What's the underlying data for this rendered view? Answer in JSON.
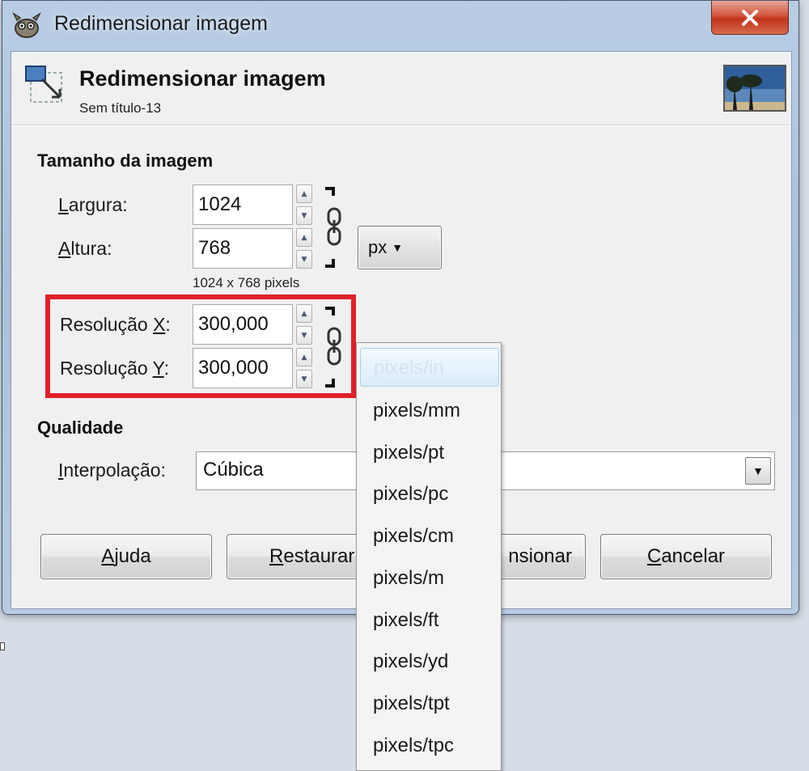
{
  "window": {
    "title": "Redimensionar imagem"
  },
  "dialog": {
    "title": "Redimensionar imagem",
    "subtitle": "Sem título-13"
  },
  "image_size": {
    "section_title": "Tamanho da imagem",
    "width": {
      "label_mnemonic": "L",
      "label_rest": "argura:",
      "value": "1024"
    },
    "height": {
      "label_mnemonic": "A",
      "label_rest": "ltura:",
      "value": "768"
    },
    "unit": "px",
    "pixels_note": "1024 x 768 pixels",
    "resolution_x": {
      "label_pre": "Resolução ",
      "label_mnemonic": "X",
      "label_post": ":",
      "value": "300,000"
    },
    "resolution_y": {
      "label_pre": "Resolução ",
      "label_mnemonic": "Y",
      "label_post": ":",
      "value": "300,000"
    }
  },
  "quality": {
    "section_title": "Qualidade",
    "interpolation": {
      "label_mnemonic": "I",
      "label_rest": "nterpolação:",
      "value": "Cúbica"
    }
  },
  "buttons": {
    "help": {
      "mnemonic": "A",
      "rest": "juda"
    },
    "reset": {
      "mnemonic": "R",
      "rest": "estaurar"
    },
    "resize": "nsionar",
    "cancel": {
      "mnemonic": "C",
      "rest": "ancelar"
    }
  },
  "resolution_unit_menu": {
    "items": [
      "pixels/in",
      "pixels/mm",
      "pixels/pt",
      "pixels/pc",
      "pixels/cm",
      "pixels/m",
      "pixels/ft",
      "pixels/yd",
      "pixels/tpt",
      "pixels/tpc"
    ],
    "selected_index": 0
  },
  "colors": {
    "highlight": "#e0202a",
    "window_frame": "#a9c0dc",
    "close_button": "#c0341a",
    "selection": "#dcecfc"
  },
  "icons": {
    "app": "gimp-wilber-icon",
    "close": "close-icon",
    "dialog": "resize-image-icon",
    "chain": "chain-link-icon",
    "spin_up": "arrow-up-icon",
    "spin_down": "arrow-down-icon",
    "dropdown": "chevron-down-icon"
  }
}
